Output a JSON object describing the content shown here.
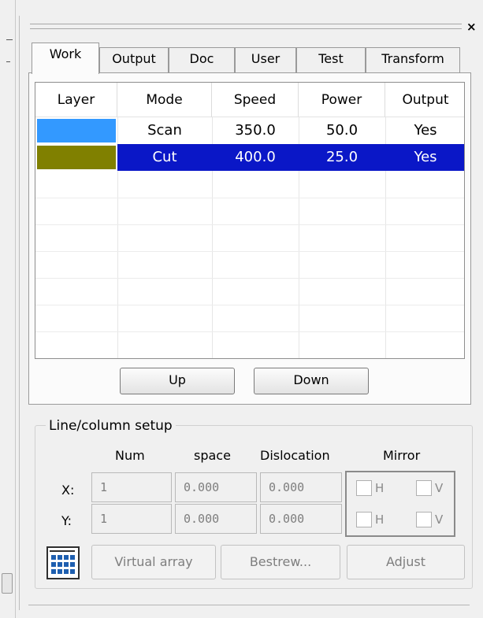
{
  "panel": {
    "close_label": "×"
  },
  "tabs": [
    {
      "label": "Work",
      "active": true
    },
    {
      "label": "Output",
      "active": false
    },
    {
      "label": "Doc",
      "active": false
    },
    {
      "label": "User",
      "active": false
    },
    {
      "label": "Test",
      "active": false
    },
    {
      "label": "Transform",
      "active": false
    }
  ],
  "layers_table": {
    "columns": [
      "Layer",
      "Mode",
      "Speed",
      "Power",
      "Output"
    ],
    "rows": [
      {
        "layer_color": "#3399ff",
        "mode": "Scan",
        "speed": "350.0",
        "power": "50.0",
        "output": "Yes",
        "selected": false
      },
      {
        "layer_color": "#808000",
        "mode": "Cut",
        "speed": "400.0",
        "power": "25.0",
        "output": "Yes",
        "selected": true
      }
    ]
  },
  "buttons": {
    "up": "Up",
    "down": "Down"
  },
  "line_column_setup": {
    "title": "Line/column setup",
    "headers": {
      "num": "Num",
      "space": "space",
      "dislocation": "Dislocation",
      "mirror": "Mirror"
    },
    "x": {
      "label": "X:",
      "num": "1",
      "space": "0.000",
      "dislocation": "0.000",
      "mirror_h": "H",
      "mirror_v": "V"
    },
    "y": {
      "label": "Y:",
      "num": "1",
      "space": "0.000",
      "dislocation": "0.000",
      "mirror_h": "H",
      "mirror_v": "V"
    },
    "virtual_array": "Virtual array",
    "bestrew": "Bestrew...",
    "adjust": "Adjust",
    "array_icon": "array-grid-icon"
  },
  "colors": {
    "selection": "#0a17c7",
    "panel_bg": "#f0f0f0",
    "disabled_text": "#7e7e7e"
  }
}
